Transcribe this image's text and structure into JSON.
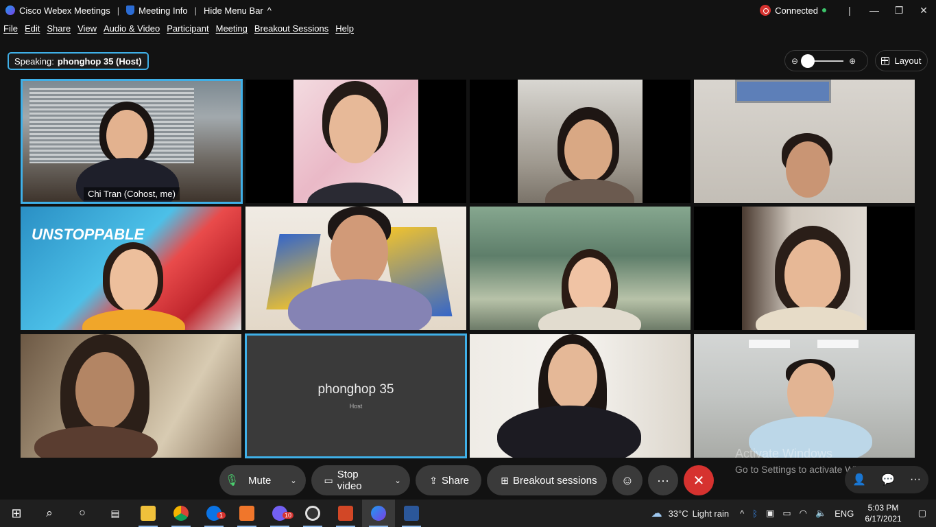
{
  "titlebar": {
    "app_name": "Cisco Webex Meetings",
    "meeting_info": "Meeting Info",
    "hide_menu": "Hide Menu Bar",
    "status": "Connected"
  },
  "menu": [
    "File",
    "Edit",
    "Share",
    "View",
    "Audio & Video",
    "Participant",
    "Meeting",
    "Breakout Sessions",
    "Help"
  ],
  "speaking": {
    "label": "Speaking:",
    "name": "phonghop 35 (Host)"
  },
  "layout_label": "Layout",
  "tiles": {
    "t1_name": "Chi Tran  (Cohost, me)",
    "host_name": "phonghop 35",
    "host_role": "Host"
  },
  "watermark": {
    "title": "Activate Windows",
    "subtitle": "Go to Settings to activate Windows."
  },
  "controls": {
    "mute": "Mute",
    "stop_video": "Stop video",
    "share": "Share",
    "breakout": "Breakout sessions"
  },
  "taskbar": {
    "weather_temp": "33°C",
    "weather_desc": "Light rain",
    "lang": "ENG",
    "time": "5:03 PM",
    "date": "6/17/2021",
    "zalo_badge": "1",
    "viber_badge": "10"
  },
  "colors": {
    "accent": "#3fb0e8",
    "end_call": "#d6322f",
    "background": "#121212"
  }
}
